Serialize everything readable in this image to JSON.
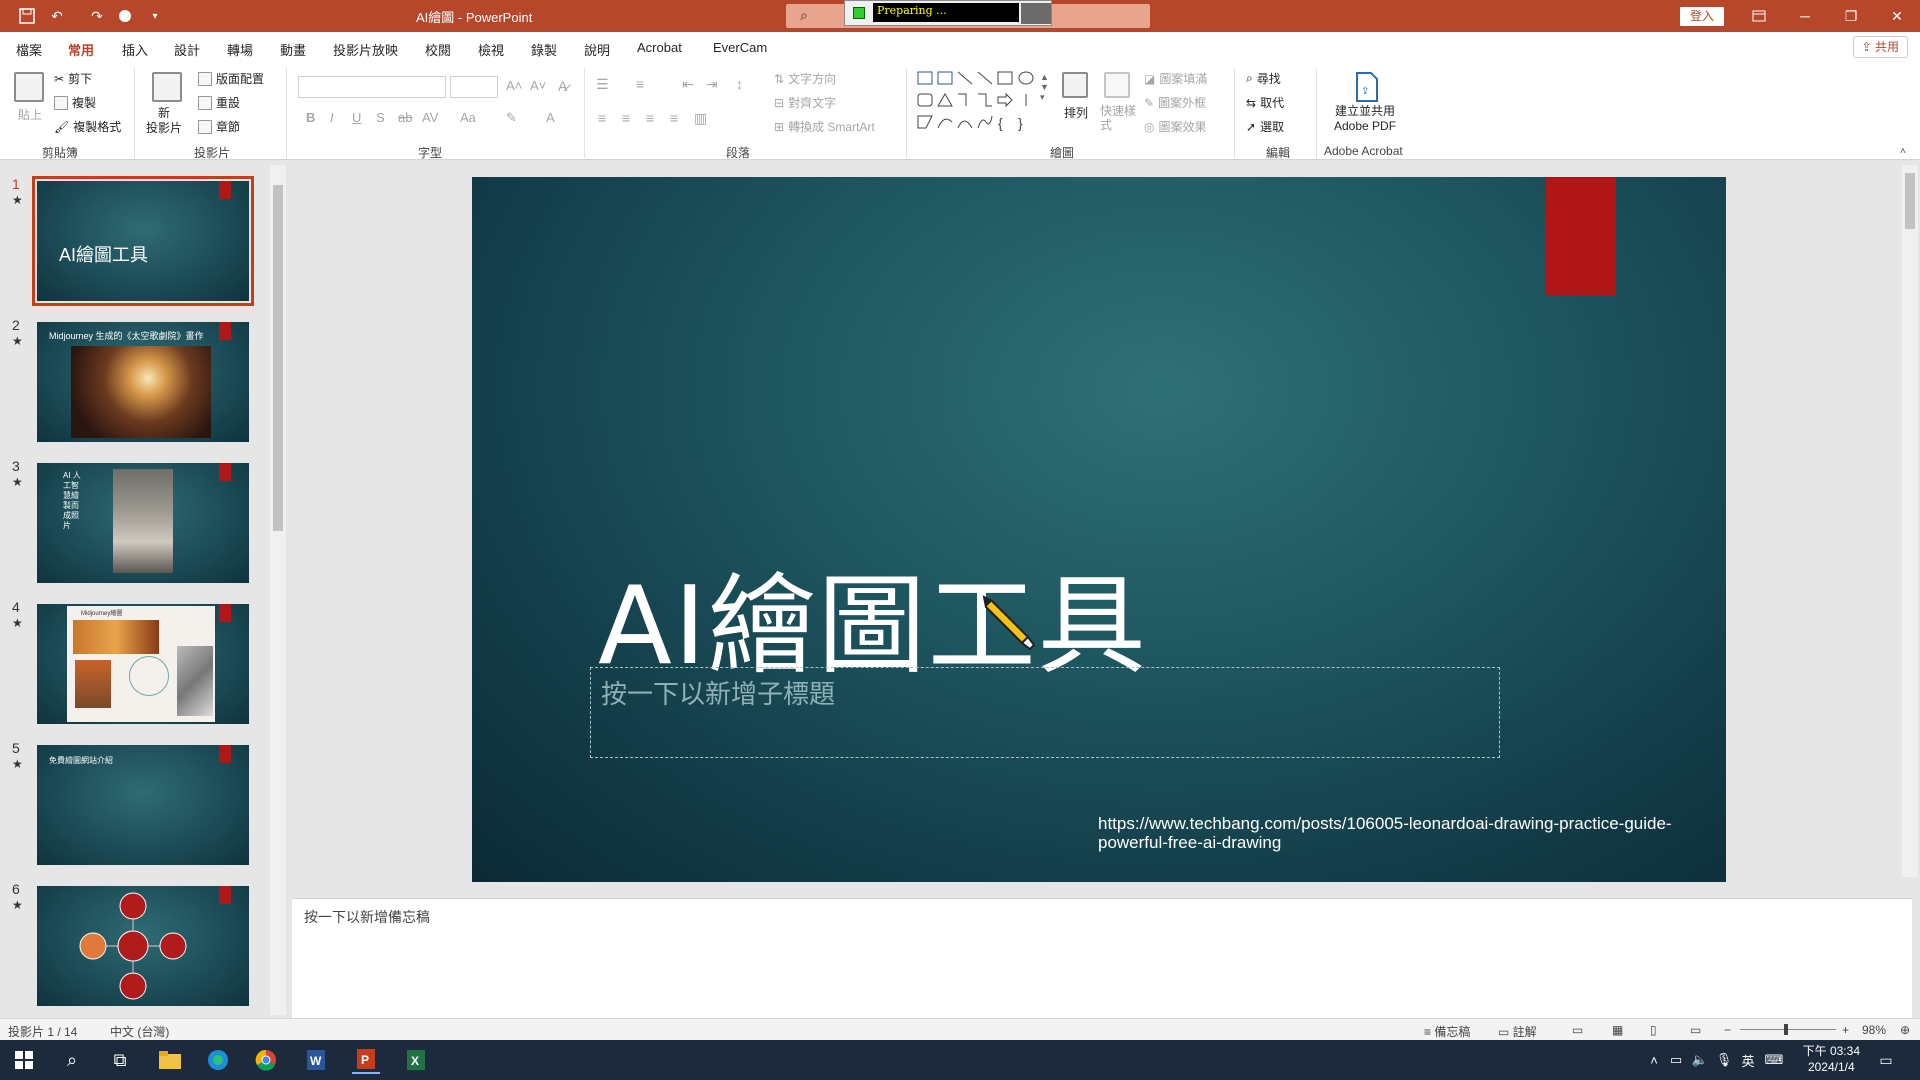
{
  "window": {
    "title": "AI繪圖 - PowerPoint",
    "signin": "登入",
    "preparing": "Preparing ...",
    "minimize": "─",
    "restore": "❐",
    "close": "✕"
  },
  "tabs": [
    "檔案",
    "常用",
    "插入",
    "設計",
    "轉場",
    "動畫",
    "投影片放映",
    "校閱",
    "檢視",
    "錄製",
    "說明",
    "Acrobat",
    "EverCam"
  ],
  "share": "共用",
  "ribbon": {
    "clipboard": {
      "label": "剪貼簿",
      "paste": "貼上",
      "cut": "剪下",
      "copy": "複製",
      "format_painter": "複製格式"
    },
    "slides": {
      "label": "投影片",
      "new_slide": "新\n投影片",
      "layout": "版面配置",
      "reset": "重設",
      "section": "章節"
    },
    "font": {
      "label": "字型"
    },
    "paragraph": {
      "label": "段落",
      "text_direction": "文字方向",
      "align_text": "對齊文字",
      "smartart": "轉換成 SmartArt"
    },
    "drawing": {
      "label": "繪圖",
      "arrange": "排列",
      "quick_styles": "快速樣式",
      "shape_fill": "圖案填滿",
      "shape_outline": "圖案外框",
      "shape_effects": "圖案效果"
    },
    "editing": {
      "label": "編輯",
      "find": "尋找",
      "replace": "取代",
      "select": "選取"
    },
    "acrobat": {
      "label": "Adobe Acrobat",
      "create_share": "建立並共用\nAdobe PDF"
    }
  },
  "thumbnails": [
    {
      "num": "1",
      "title": "AI繪圖工具"
    },
    {
      "num": "2",
      "title": "Midjourney 生成的《太空歌劇院》畫作"
    },
    {
      "num": "3",
      "title": "AI 人工智慧繪製而成照片"
    },
    {
      "num": "4",
      "title": "Midjourney繪圖"
    },
    {
      "num": "5",
      "title": "免費繪圖網站介紹"
    },
    {
      "num": "6",
      "title": ""
    }
  ],
  "slide": {
    "title": "AI繪圖工具",
    "subtitle_placeholder": "按一下以新增子標題",
    "url": "https://www.techbang.com/posts/106005-leonardoai-drawing-practice-guide-powerful-free-ai-drawing"
  },
  "notes_placeholder": "按一下以新增備忘稿",
  "status": {
    "slide_of": "投影片 1 / 14",
    "language": "中文 (台灣)",
    "notes": "備忘稿",
    "comments": "註解",
    "zoom": "98%"
  },
  "taskbar": {
    "time": "下午 03:34",
    "date": "2024/1/4",
    "ime": "英"
  },
  "colors": {
    "accent": "#b7472a",
    "slide_bg": "#1e5660",
    "slide_ribbon": "#b01616"
  }
}
